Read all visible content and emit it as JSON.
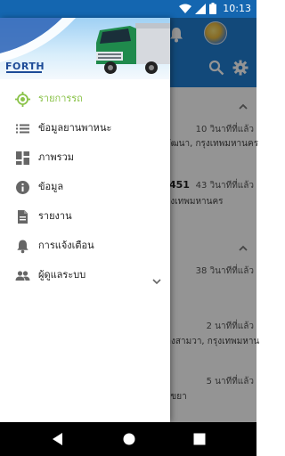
{
  "status_bar": {
    "time": "10:13",
    "icons": [
      "wifi-icon",
      "signal-icon",
      "battery-icon"
    ]
  },
  "colors": {
    "status_bar": "#1466b0",
    "app_bar": "#1f7fd2",
    "active": "#8bc34a",
    "icon_gray": "#666666"
  },
  "app": {
    "header_icons": [
      "bell-icon",
      "app-logo",
      "search-icon",
      "settings-icon"
    ],
    "background_rows": [
      {
        "time": "10 วินาทีที่แล้ว",
        "address": "วัฒนา, กรุงเทพมหานคร"
      },
      {
        "plate": "451",
        "time": "43 วินาทีที่แล้ว",
        "address": "รุงเทพมหานคร"
      },
      {
        "time": "38 วินาทีที่แล้ว"
      },
      {
        "time": "2 นาทีที่แล้ว",
        "address": "องสามวา, กรุงเทพมหาน"
      },
      {
        "time": "5 นาทีที่แล้ว",
        "address": "ะขยา"
      }
    ]
  },
  "drawer": {
    "brand": "FORTH",
    "menu": [
      {
        "label": "รายการรถ",
        "icon": "gps-target-icon",
        "active": true
      },
      {
        "label": "ข้อมูลยานพาหนะ",
        "icon": "list-icon",
        "active": false
      },
      {
        "label": "ภาพรวม",
        "icon": "dashboard-icon",
        "active": false
      },
      {
        "label": "ข้อมูล",
        "icon": "info-icon",
        "active": false
      },
      {
        "label": "รายงาน",
        "icon": "document-icon",
        "active": false
      },
      {
        "label": "การแจ้งเตือน",
        "icon": "bell-icon",
        "active": false
      },
      {
        "label": "ผู้ดูแลระบบ",
        "icon": "people-icon",
        "active": false,
        "expandable": true
      }
    ]
  },
  "nav_bar": {
    "buttons": [
      "back-icon",
      "home-icon",
      "recents-icon"
    ]
  }
}
